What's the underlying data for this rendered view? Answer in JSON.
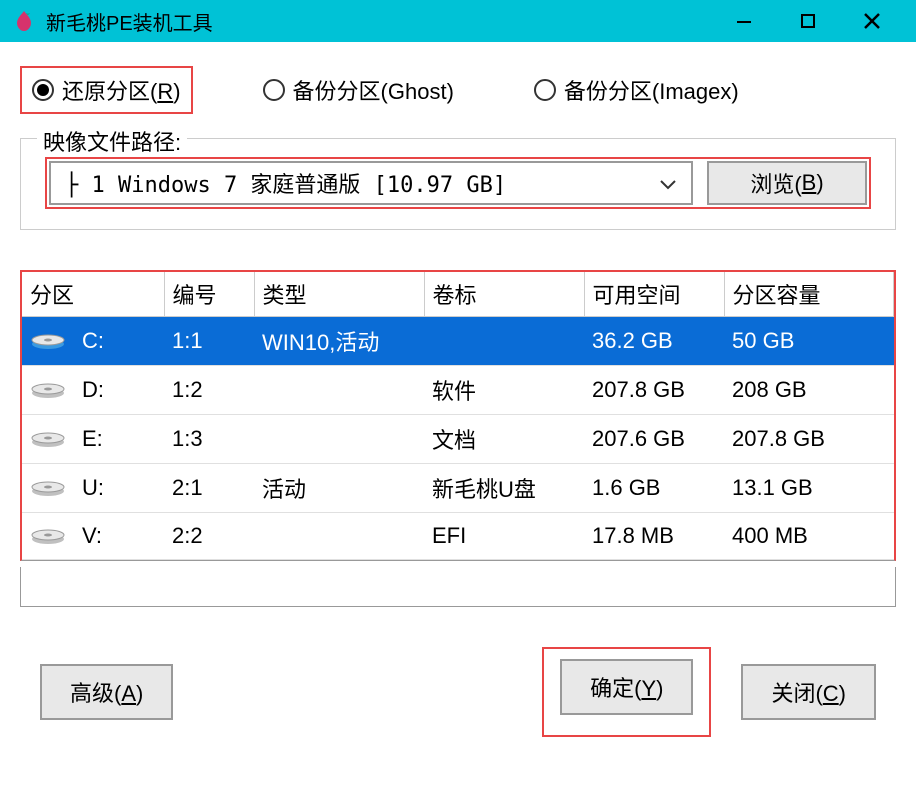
{
  "titlebar": {
    "title": "新毛桃PE装机工具"
  },
  "radios": {
    "restore": "还原分区(R)",
    "backup_ghost": "备份分区(Ghost)",
    "backup_imagex": "备份分区(Imagex)"
  },
  "image_path": {
    "label": "映像文件路径:",
    "selected": "├ 1 Windows 7 家庭普通版 [10.97 GB]",
    "browse": "浏览(B)"
  },
  "table": {
    "headers": {
      "partition": "分区",
      "number": "编号",
      "type": "类型",
      "label": "卷标",
      "free": "可用空间",
      "capacity": "分区容量"
    },
    "rows": [
      {
        "drive": "C:",
        "num": "1:1",
        "type": "WIN10,活动",
        "label": "",
        "free": "36.2 GB",
        "cap": "50 GB",
        "selected": true,
        "icon": "blue"
      },
      {
        "drive": "D:",
        "num": "1:2",
        "type": "",
        "label": "软件",
        "free": "207.8 GB",
        "cap": "208 GB",
        "selected": false,
        "icon": "gray"
      },
      {
        "drive": "E:",
        "num": "1:3",
        "type": "",
        "label": "文档",
        "free": "207.6 GB",
        "cap": "207.8 GB",
        "selected": false,
        "icon": "gray"
      },
      {
        "drive": "U:",
        "num": "2:1",
        "type": "活动",
        "label": "新毛桃U盘",
        "free": "1.6 GB",
        "cap": "13.1 GB",
        "selected": false,
        "icon": "gray"
      },
      {
        "drive": "V:",
        "num": "2:2",
        "type": "",
        "label": "EFI",
        "free": "17.8 MB",
        "cap": "400 MB",
        "selected": false,
        "icon": "gray"
      }
    ]
  },
  "buttons": {
    "advanced": "高级(A)",
    "ok": "确定(Y)",
    "close": "关闭(C)"
  }
}
